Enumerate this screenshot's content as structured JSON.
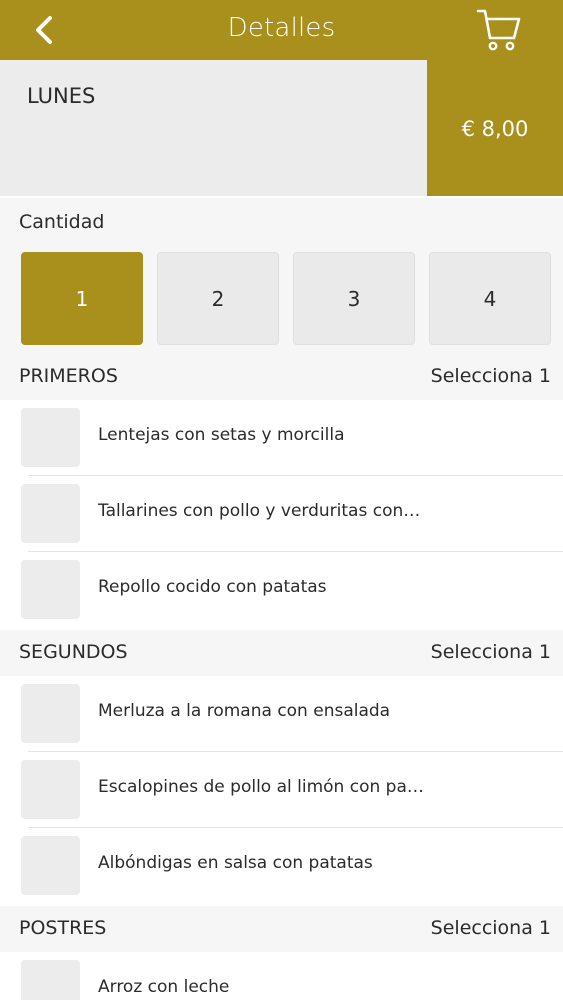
{
  "header": {
    "title": "Detalles",
    "back_icon": "chevron-left-icon",
    "cart_icon": "shopping-cart-icon"
  },
  "day": {
    "label": "LUNES",
    "price": "€ 8,00"
  },
  "quantity": {
    "label": "Cantidad",
    "options": [
      "1",
      "2",
      "3",
      "4"
    ],
    "selected": "1"
  },
  "sections": [
    {
      "title": "PRIMEROS",
      "hint": "Selecciona 1",
      "items": [
        "Lentejas con setas y morcilla",
        "Tallarines con pollo y verduritas con…",
        "Repollo cocido con patatas"
      ]
    },
    {
      "title": "SEGUNDOS",
      "hint": "Selecciona 1",
      "items": [
        "Merluza a la romana con ensalada",
        "Escalopines de pollo al limón con pa…",
        "Albóndigas en salsa con patatas"
      ]
    },
    {
      "title": "POSTRES",
      "hint": "Selecciona 1",
      "items": [
        "Arroz con leche"
      ]
    }
  ],
  "colors": {
    "accent": "#a98f1b",
    "tile": "#ececec",
    "section_bg": "#f6f6f6"
  }
}
